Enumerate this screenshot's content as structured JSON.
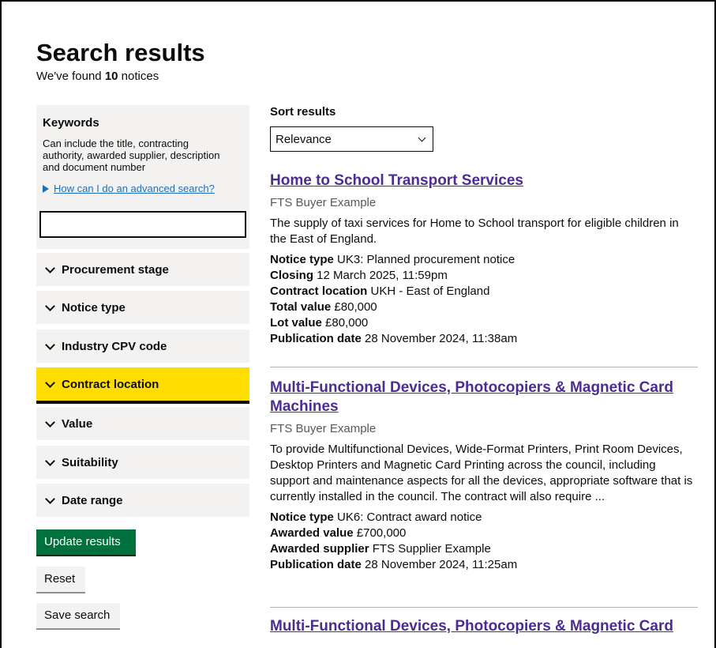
{
  "page": {
    "title": "Search results",
    "found_prefix": "We've found",
    "found_count": "10",
    "found_suffix": "notices"
  },
  "sidebar": {
    "keywords_title": "Keywords",
    "keywords_hint": "Can include the title, contracting authority, awarded supplier, description and document number",
    "advanced_link": "How can I do an advanced search?",
    "keywords_value": "",
    "filters": [
      {
        "label": "Procurement stage"
      },
      {
        "label": "Notice type"
      },
      {
        "label": "Industry CPV code"
      },
      {
        "label": "Contract location"
      },
      {
        "label": "Value"
      },
      {
        "label": "Suitability"
      },
      {
        "label": "Date range"
      }
    ],
    "update_button": "Update results",
    "reset_button": "Reset",
    "save_button": "Save search"
  },
  "sort": {
    "label": "Sort results",
    "selected": "Relevance"
  },
  "results": [
    {
      "title": "Home to School Transport Services",
      "org": "FTS Buyer Example",
      "description": "The supply of taxi services for Home to School transport for eligible children in the East of England.",
      "meta": [
        {
          "k": "Notice type",
          "v": "UK3: Planned procurement notice"
        },
        {
          "k": "Closing",
          "v": "12 March 2025, 11:59pm"
        },
        {
          "k": "Contract location",
          "v": "UKH - East of England"
        },
        {
          "k": "Total value",
          "v": "£80,000"
        },
        {
          "k": "Lot value",
          "v": "£80,000"
        },
        {
          "k": "Publication date",
          "v": "28 November 2024, 11:38am"
        }
      ]
    },
    {
      "title": "Multi-Functional Devices, Photocopiers & Magnetic Card Machines",
      "org": "FTS Buyer Example",
      "description": "To provide Multifunctional Devices, Wide-Format Printers, Print Room Devices, Desktop Printers and Magnetic Card Printing across the council, including support and maintenance aspects for all the devices, appropriate software that is currently installed in the council. The contract will also require ...",
      "meta": [
        {
          "k": "Notice type",
          "v": "UK6: Contract award notice"
        },
        {
          "k": "Awarded value",
          "v": "£700,000"
        },
        {
          "k": "Awarded supplier",
          "v": "FTS Supplier Example"
        },
        {
          "k": "Publication date",
          "v": "28 November 2024, 11:25am"
        }
      ]
    },
    {
      "title": "Multi-Functional Devices, Photocopiers & Magnetic Card"
    }
  ]
}
